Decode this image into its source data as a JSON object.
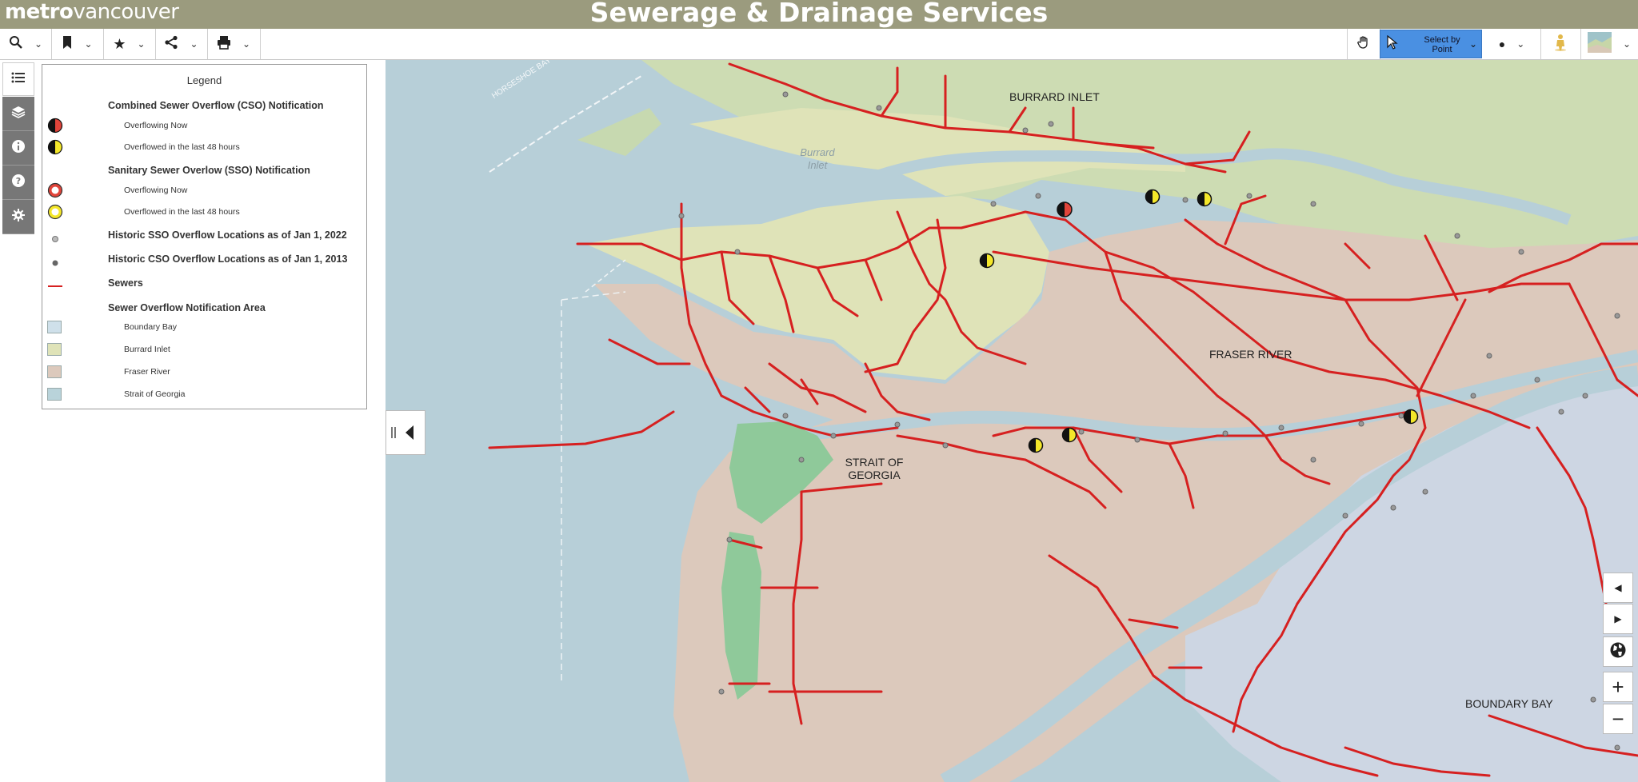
{
  "header": {
    "logo_bold": "metro",
    "logo_light": "vancouver",
    "title": "Sewerage & Drainage Services"
  },
  "toolbar": {
    "left_tools": [
      {
        "name": "search",
        "icon": "search-icon"
      },
      {
        "name": "bookmark",
        "icon": "bookmark-icon"
      },
      {
        "name": "favorite",
        "icon": "star-icon"
      },
      {
        "name": "share",
        "icon": "share-icon"
      },
      {
        "name": "print",
        "icon": "print-icon"
      }
    ],
    "select_label": "Select by Point"
  },
  "legend": {
    "title": "Legend",
    "cso_heading": "Combined Sewer Overflow (CSO) Notification",
    "cso_now": "Overflowing Now",
    "cso_48": "Overflowed in the last 48 hours",
    "sso_heading": "Sanitary Sewer Overlow (SSO) Notification",
    "sso_now": "Overflowing Now",
    "sso_48": "Overflowed in the last 48 hours",
    "historic_sso": "Historic SSO Overflow Locations as of Jan 1, 2022",
    "historic_cso": "Historic CSO Overflow Locations as of Jan 1, 2013",
    "sewers": "Sewers",
    "area_heading": "Sewer Overflow Notification Area",
    "areas": [
      "Boundary Bay",
      "Burrard Inlet",
      "Fraser River",
      "Strait of Georgia"
    ]
  },
  "map": {
    "labels": {
      "burrard_inlet": "BURRARD INLET",
      "fraser_river": "FRASER RIVER",
      "strait": "STRAIT OF GEORGIA",
      "boundary_bay": "BOUNDARY BAY",
      "burrard_water": "Burrard Inlet",
      "horseshoe": "HORSESHOE BAY-DEPARTURE"
    }
  },
  "colors": {
    "header": "#9b9b7e",
    "sewer": "#d62020",
    "burrard_area": "#dfe3b8",
    "fraser_area": "#dcc9bc",
    "boundary_area": "#cdd6e3",
    "water": "#b7cfd8",
    "park": "#8fc99a"
  }
}
